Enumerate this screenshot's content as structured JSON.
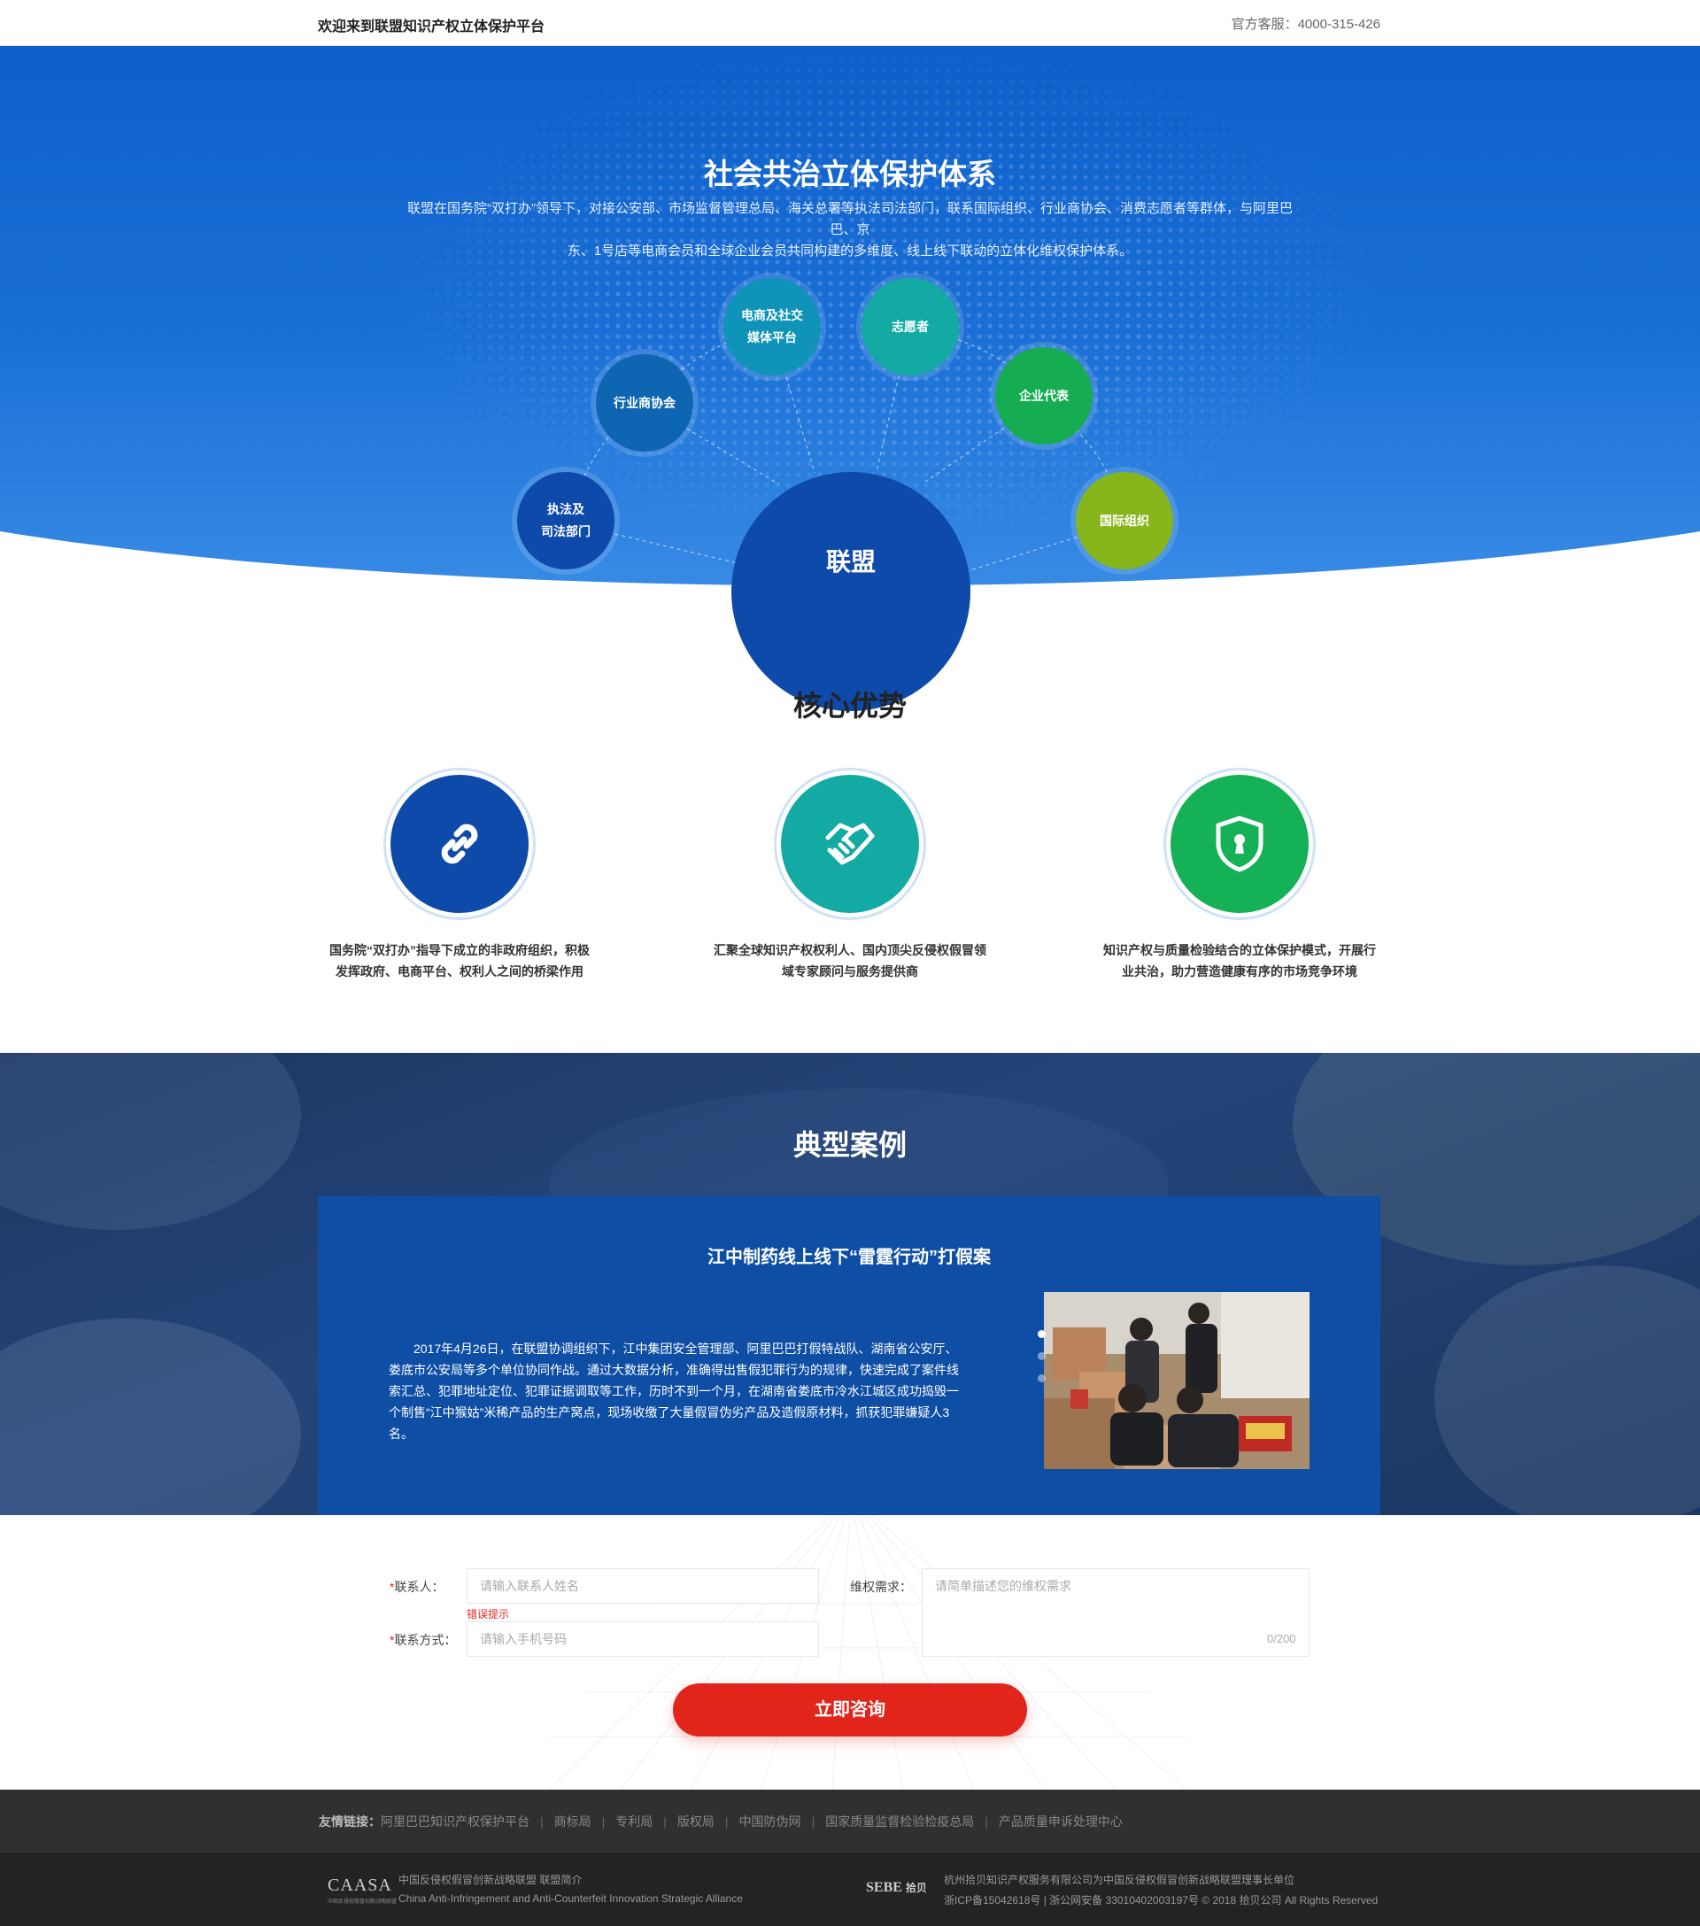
{
  "topbar": {
    "welcome": "欢迎来到联盟知识产权立体保护平台",
    "phone": "官方客服：4000-315-426"
  },
  "hero": {
    "title": "社会共治立体保护体系",
    "desc_line1": "联盟在国务院“双打办”领导下，对接公安部、市场监督管理总局、海关总署等执法司法部门，联系国际组织、行业商协会、消费志愿者等群体，与阿里巴巴、京",
    "desc_line2": "东、1号店等电商会员和全球企业会员共同构建的多维度、线上线下联动的立体化维权保护体系。",
    "center": "联盟",
    "nodes": [
      {
        "line1": "执法及",
        "line2": "司法部门",
        "color": "#0d4aa9"
      },
      {
        "line1": "行业商协会",
        "line2": "",
        "color": "#0e66b3"
      },
      {
        "line1": "电商及社交",
        "line2": "媒体平台",
        "color": "#0f93b8"
      },
      {
        "line1": "志愿者",
        "line2": "",
        "color": "#12aaa2"
      },
      {
        "line1": "企业代表",
        "line2": "",
        "color": "#16ac52"
      },
      {
        "line1": "国际组织",
        "line2": "",
        "color": "#86b61b"
      }
    ]
  },
  "advantages": {
    "title": "核心优势",
    "items": [
      {
        "icon": "link-icon",
        "color": "#0d4aa9",
        "line1": "国务院“双打办”指导下成立的非政府组织，积极",
        "line2": "发挥政府、电商平台、权利人之间的桥梁作用"
      },
      {
        "icon": "handshake-icon",
        "color": "#12aaa2",
        "line1": "汇聚全球知识产权权利人、国内顶尖反侵权假冒领",
        "line2": "域专家顾问与服务提供商"
      },
      {
        "icon": "shield-lock-icon",
        "color": "#14b156",
        "line1": "知识产权与质量检验结合的立体保护模式，开展行",
        "line2": "业共治，助力营造健康有序的市场竞争环境"
      }
    ]
  },
  "cases": {
    "title": "典型案例",
    "case_title": "江中制药线上线下“雷霆行动”打假案",
    "case_text": "2017年4月26日，在联盟协调组织下，江中集团安全管理部、阿里巴巴打假特战队、湖南省公安厅、娄底市公安局等多个单位协同作战。通过大数据分析，准确得出售假犯罪行为的规律，快速完成了案件线索汇总、犯罪地址定位、犯罪证据调取等工作，历时不到一个月，在湖南省娄底市冷水江城区成功捣毁一个制售“江中猴姑”米稀产品的生产窝点，现场收缴了大量假冒伪劣产品及造假原材料，抓获犯罪嫌疑人3名。",
    "slide_active": 1,
    "slide_total": 3
  },
  "form": {
    "required_mark": "*",
    "contact_label": "联系人：",
    "contact_placeholder": "请输入联系人姓名",
    "contact_error": "错误提示",
    "phone_label": "联系方式：",
    "phone_placeholder": "请输入手机号码",
    "need_label": "维权需求：",
    "need_placeholder": "请简单描述您的维权需求",
    "need_counter": "0/200",
    "submit": "立即咨询"
  },
  "footer": {
    "links_label": "友情链接：",
    "links": [
      "阿里巴巴知识产权保护平台",
      "商标局",
      "专利局",
      "版权局",
      "中国防伪网",
      "国家质量监督检验检疫总局",
      "产品质量申诉处理中心"
    ],
    "caasa_logo": "CAASA",
    "caasa_sub": "中国反侵权假冒创新战略联盟",
    "caasa_line1": "中国反侵权假冒创新战略联盟  联盟简介",
    "caasa_line2": "China Anti-Infringement and Anti-Counterfeit Innovation Strategic Alliance",
    "sebe_logo": "SEBE",
    "sebe_cn": "拾贝",
    "sebe_line1": "杭州拾贝知识产权服务有限公司为中国反侵权假冒创新战略联盟理事长单位",
    "sebe_line2": "浙ICP备15042618号 | 浙公网安备 33010402003197号 © 2018 拾贝公司 All Rights Reserved"
  }
}
